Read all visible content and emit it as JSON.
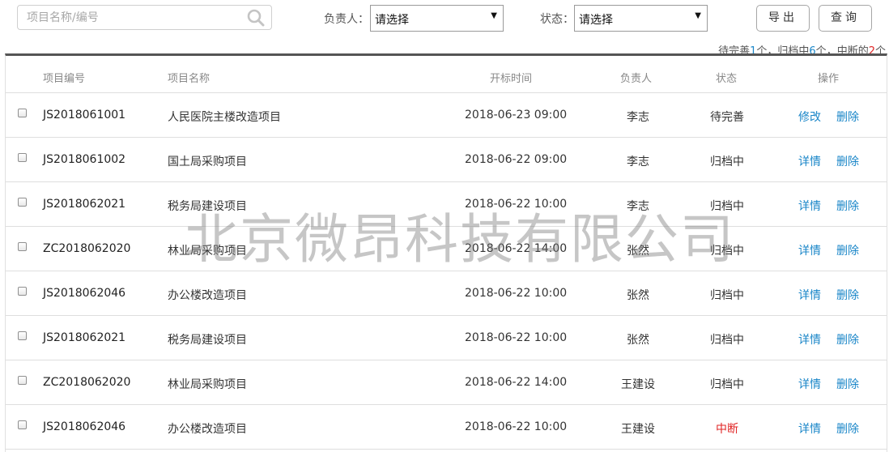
{
  "search": {
    "placeholder": "项目名称/编号",
    "value": "",
    "icon": "search-icon"
  },
  "filters": {
    "owner": {
      "label": "负责人：",
      "selected": "请选择"
    },
    "status": {
      "label": "状态：",
      "selected": "请选择"
    }
  },
  "buttons": {
    "export": "导出",
    "query": "查询"
  },
  "summary": {
    "pending_label": "待完善",
    "pending_count": "1",
    "pending_unit": "个，",
    "archiving_label": "归档中",
    "archiving_count": "6",
    "archiving_unit": "个，",
    "interrupted_label": "中断的",
    "interrupted_count": "2",
    "interrupted_unit": "个",
    "colors": {
      "count_blue": "#1a86c8",
      "count_red": "#e02424"
    }
  },
  "table": {
    "columns": [
      "项目编号",
      "项目名称",
      "开标时间",
      "负责人",
      "状态",
      "操作"
    ],
    "rows": [
      {
        "code": "JS2018061001",
        "name": "人民医院主楼改造项目",
        "time": "2018-06-23  09:00",
        "owner": "李志",
        "status": "待完善",
        "status_color": "normal",
        "action1": "修改",
        "action2": "删除"
      },
      {
        "code": "JS2018061002",
        "name": "国土局采购项目",
        "time": "2018-06-22  09:00",
        "owner": "李志",
        "status": "归档中",
        "status_color": "normal",
        "action1": "详情",
        "action2": "删除"
      },
      {
        "code": "JS2018062021",
        "name": "税务局建设项目",
        "time": "2018-06-22  10:00",
        "owner": "李志",
        "status": "归档中",
        "status_color": "normal",
        "action1": "详情",
        "action2": "删除"
      },
      {
        "code": "ZC2018062020",
        "name": "林业局采购项目",
        "time": "2018-06-22  14:00",
        "owner": "张然",
        "status": "归档中",
        "status_color": "normal",
        "action1": "详情",
        "action2": "删除"
      },
      {
        "code": "JS2018062046",
        "name": "办公楼改造项目",
        "time": "2018-06-22  10:00",
        "owner": "张然",
        "status": "归档中",
        "status_color": "normal",
        "action1": "详情",
        "action2": "删除"
      },
      {
        "code": "JS2018062021",
        "name": "税务局建设项目",
        "time": "2018-06-22  10:00",
        "owner": "张然",
        "status": "归档中",
        "status_color": "normal",
        "action1": "详情",
        "action2": "删除"
      },
      {
        "code": "ZC2018062020",
        "name": "林业局采购项目",
        "time": "2018-06-22  14:00",
        "owner": "王建设",
        "status": "归档中",
        "status_color": "normal",
        "action1": "详情",
        "action2": "删除"
      },
      {
        "code": "JS2018062046",
        "name": "办公楼改造项目",
        "time": "2018-06-22  10:00",
        "owner": "王建设",
        "status": "中断",
        "status_color": "red",
        "action1": "详情",
        "action2": "删除"
      }
    ]
  },
  "watermark": "北京微昂科技有限公司"
}
